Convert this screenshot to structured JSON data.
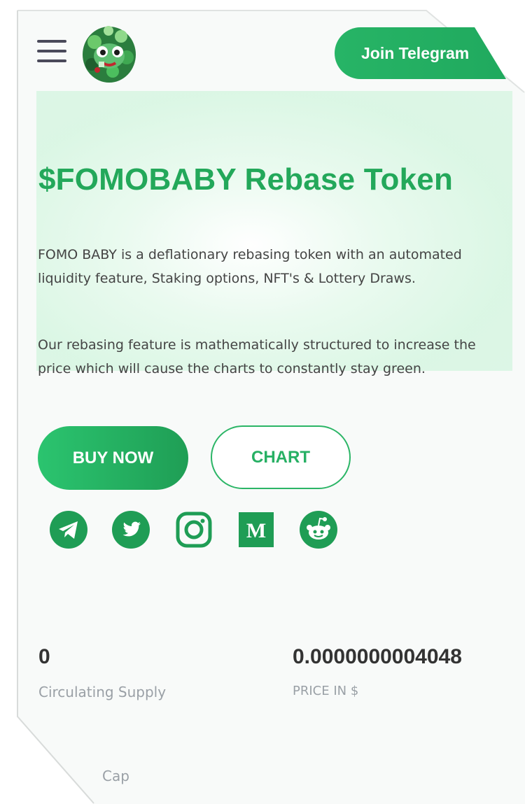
{
  "header": {
    "menu_icon": "hamburger-menu-icon",
    "logo_icon": "fomobaby-logo",
    "telegram_button_label": "Join Telegram"
  },
  "hero": {
    "title": "$FOMOBABY Rebase Token",
    "paragraph_1": "FOMO BABY is a deflationary rebasing token with an automated liquidity feature, Staking options, NFT's & Lottery Draws.",
    "paragraph_2": "Our rebasing feature is mathematically structured to increase the price which will cause the charts to constantly stay green.",
    "buy_button_label": "BUY NOW",
    "chart_button_label": "CHART"
  },
  "social_icons": [
    "telegram-icon",
    "twitter-icon",
    "instagram-icon",
    "medium-icon",
    "reddit-icon"
  ],
  "stats": {
    "circulating_supply_value": "0",
    "circulating_supply_label": "Circulating Supply",
    "price_value": "0.0000000004048",
    "price_label": "PRICE IN $",
    "market_cap_label": "Cap"
  },
  "colors": {
    "accent_green": "#23a85a",
    "button_green": "#27b466",
    "text_dark": "#333333",
    "text_muted": "#9aa0a6"
  }
}
